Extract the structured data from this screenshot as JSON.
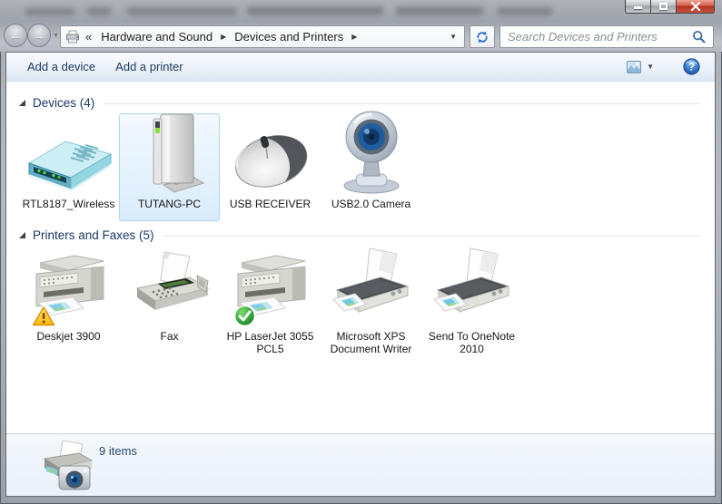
{
  "titlebar": {
    "close_glyph": "x"
  },
  "navbar": {
    "back_chevron": "«",
    "breadcrumb": [
      {
        "label": "Hardware and Sound"
      },
      {
        "label": "Devices and Printers"
      }
    ],
    "search": {
      "placeholder": "Search Devices and Printers"
    }
  },
  "toolbar": {
    "add_device_label": "Add a device",
    "add_printer_label": "Add a printer"
  },
  "groups": {
    "devices": {
      "title": "Devices (4)",
      "items": [
        {
          "label": "RTL8187_Wireless",
          "icon": "router-icon"
        },
        {
          "label": "TUTANG-PC",
          "icon": "computer-icon",
          "selected": true
        },
        {
          "label": "USB RECEIVER",
          "icon": "mouse-icon"
        },
        {
          "label": "USB2.0 Camera",
          "icon": "webcam-icon"
        }
      ]
    },
    "printers": {
      "title": "Printers and Faxes (5)",
      "items": [
        {
          "label": "Deskjet 3900",
          "icon": "inkjet-printer-icon",
          "badge": "warning"
        },
        {
          "label": "Fax",
          "icon": "fax-icon"
        },
        {
          "label": "HP LaserJet 3055 PCL5",
          "icon": "laser-printer-icon",
          "badge": "ok"
        },
        {
          "label": "Microsoft XPS Document Writer",
          "icon": "document-printer-icon"
        },
        {
          "label": "Send To OneNote 2010",
          "icon": "document-printer-icon"
        }
      ]
    }
  },
  "statusbar": {
    "count_label": "9 items"
  },
  "colors": {
    "accent_navy": "#1c3968",
    "toolbar_text": "#1f3b61",
    "selection_border": "#aed5f0",
    "selection_fill": "#d9ecfb",
    "warning_yellow": "#fcc708",
    "ok_green": "#2fa838",
    "close_red": "#b03121"
  }
}
